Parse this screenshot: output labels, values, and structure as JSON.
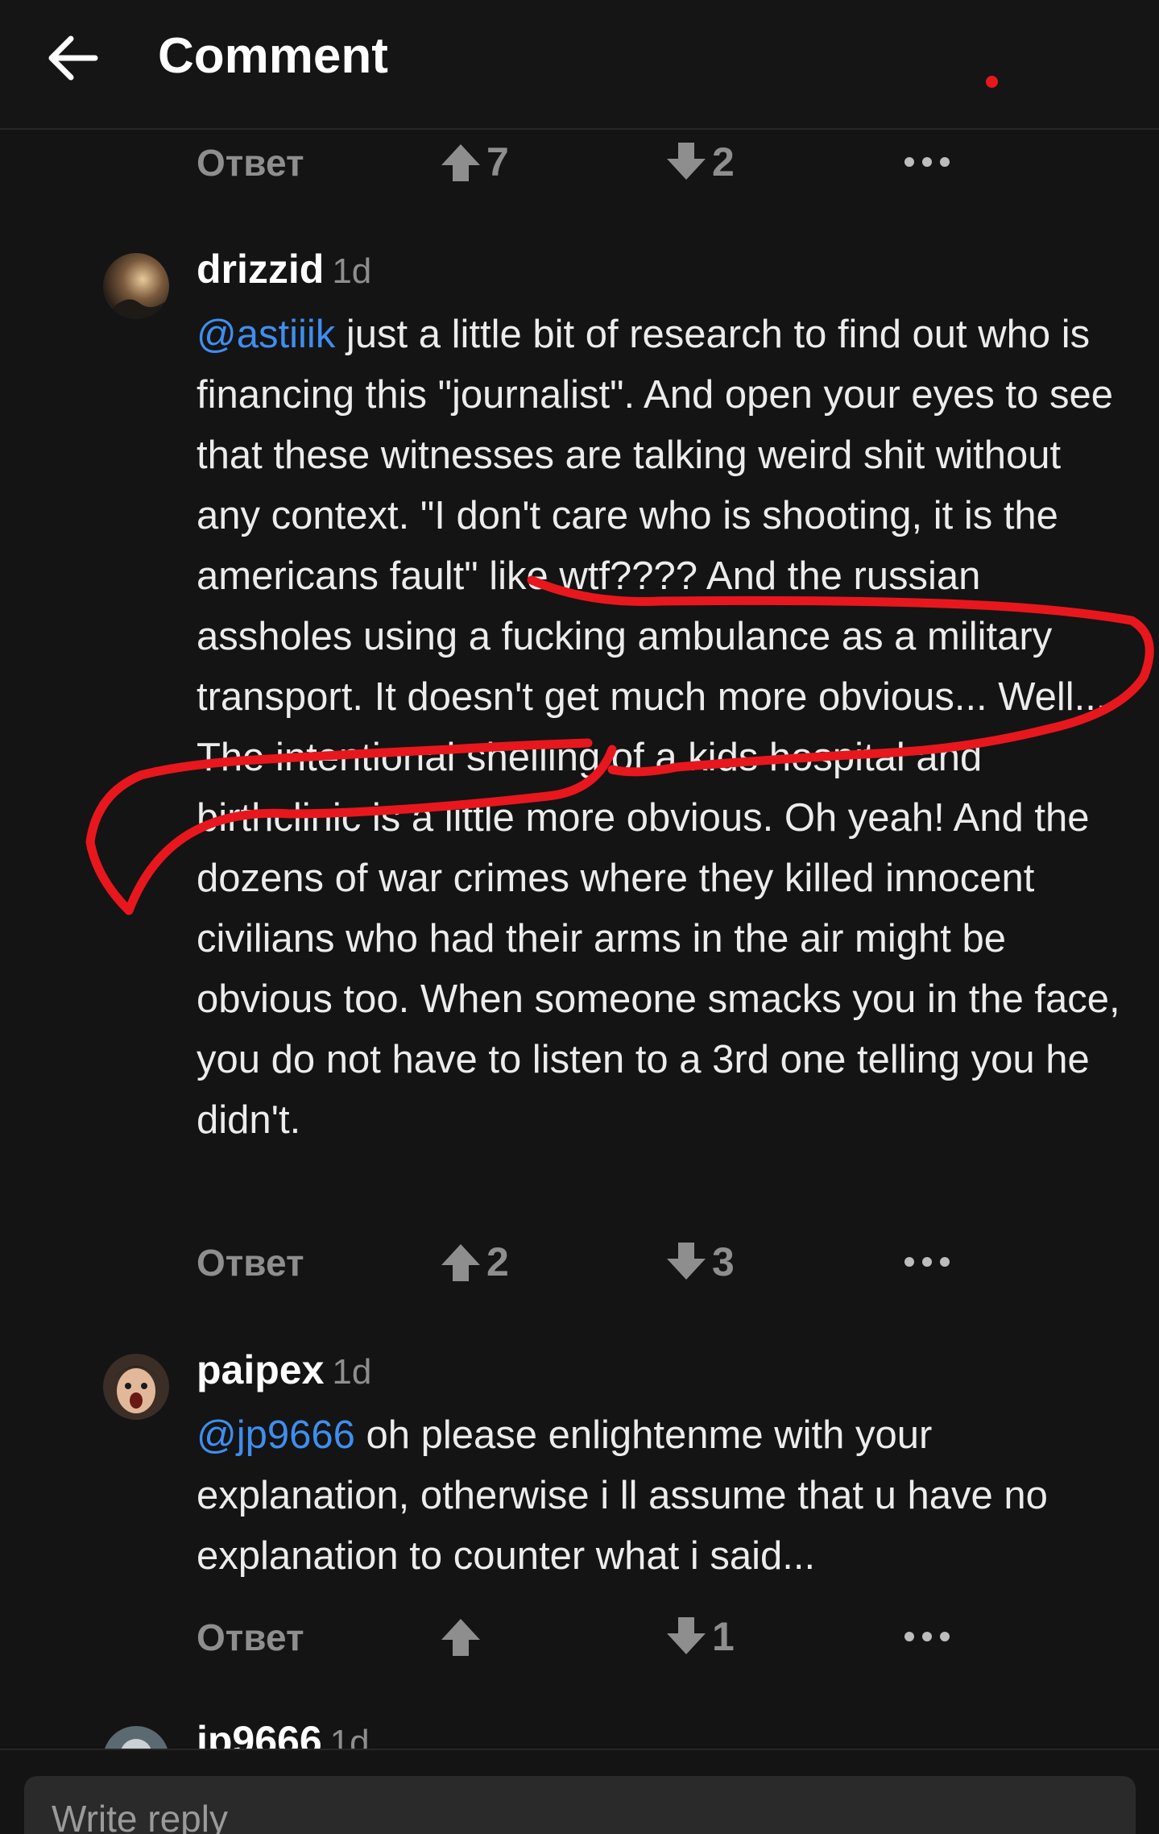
{
  "header": {
    "title": "Comment",
    "back_icon": "arrow-left-icon",
    "indicator_color": "#e8171d"
  },
  "top_actions": {
    "reply_label": "Ответ",
    "upvotes": "7",
    "downvotes": "2"
  },
  "comments": [
    {
      "username": "drizzid",
      "time": "1d",
      "mention": "@astiiik",
      "text": " just a little bit of research to find out who is financing this \"journalist\". And open your eyes to see that these witnesses are talking weird shit without any context. \"I don't care who is shooting, it is the americans fault\" like wtf???? And the russian assholes using a fucking ambulance as a military transport. It doesn't get much more obvious... Well... The intentional shelling of a kids hospital and birthclinic is a little more obvious. Oh yeah! And the dozens of war crimes where they killed innocent civilians who had their arms in the air might be obvious too. When someone smacks you in the face, you do not have to listen to a 3rd one telling you he didn't.",
      "reply_label": "Ответ",
      "upvotes": "2",
      "downvotes": "3"
    },
    {
      "username": "paipex",
      "time": "1d",
      "mention": "@jp9666",
      "text": " oh please enlightenme with your explanation, otherwise i ll assume that u have no explanation to counter what i said...",
      "reply_label": "Ответ",
      "upvotes": "",
      "downvotes": "1"
    },
    {
      "username": "jp9666",
      "time": "1d"
    }
  ],
  "composer": {
    "placeholder": "Write reply"
  },
  "colors": {
    "background": "#141414",
    "mention": "#3f8ef0",
    "muted": "#8e8e8e",
    "annotation": "#e8171d"
  }
}
